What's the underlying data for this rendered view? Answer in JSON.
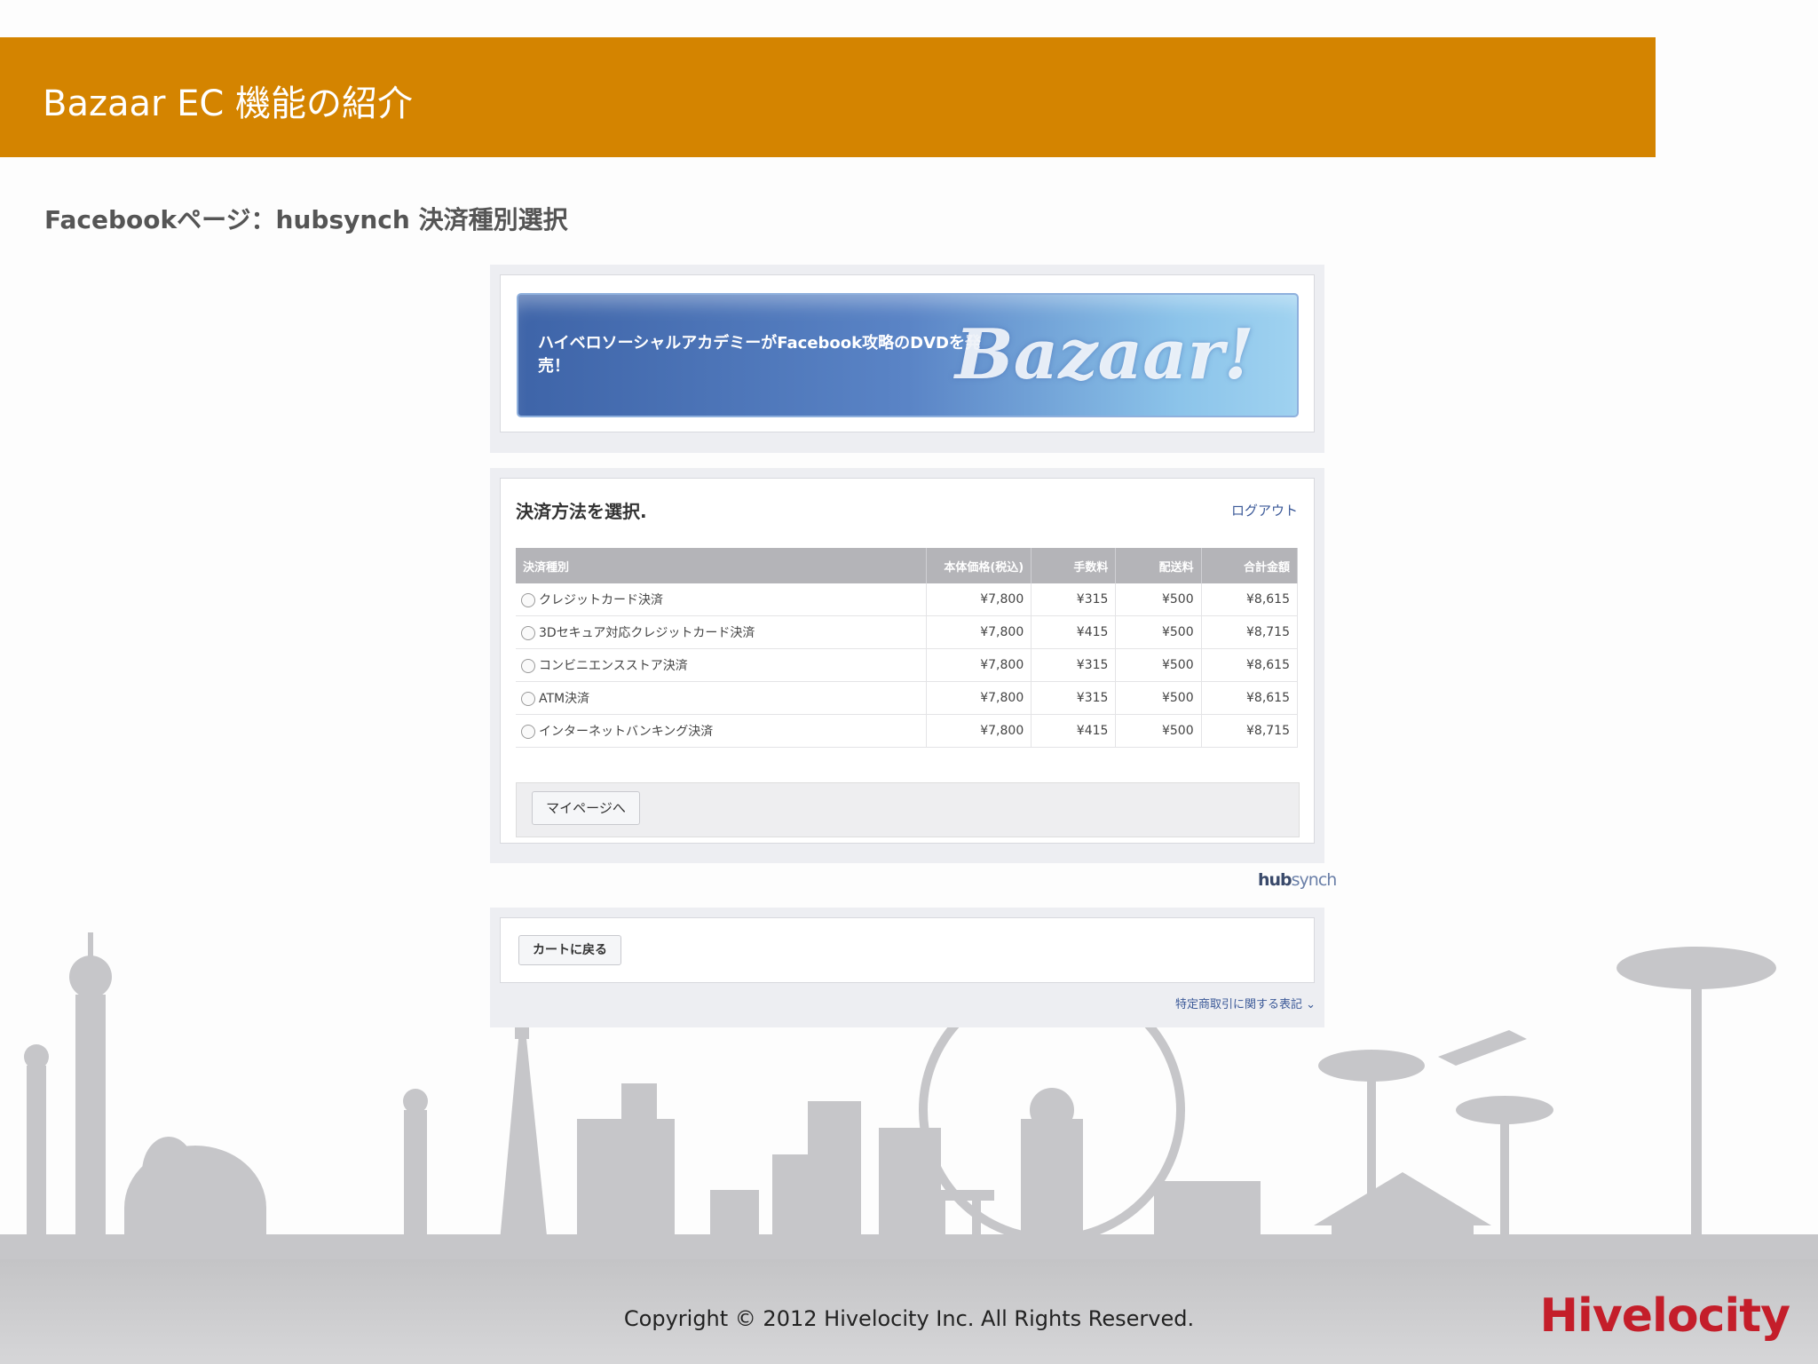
{
  "slide": {
    "title": "Bazaar EC 機能の紹介",
    "subtitle": "Facebookページ：hubsynch 決済種別選択",
    "copyright": "Copyright © 2012 Hivelocity Inc. All Rights Reserved.",
    "brand": "Hivelocity",
    "accent_color": "#d48400"
  },
  "app": {
    "banner": {
      "text": "ハイベロソーシャルアカデミーがFacebook攻略のDVDを発売！",
      "logo": "Bazaar!"
    },
    "payment": {
      "heading": "決済方法を選択.",
      "logout_label": "ログアウト",
      "columns": [
        "決済種別",
        "本体価格(税込)",
        "手数料",
        "配送料",
        "合計金額"
      ],
      "rows": [
        {
          "method": "クレジットカード決済",
          "price": "¥7,800",
          "fee": "¥315",
          "shipping": "¥500",
          "total": "¥8,615"
        },
        {
          "method": "3Dセキュア対応クレジットカード決済",
          "price": "¥7,800",
          "fee": "¥415",
          "shipping": "¥500",
          "total": "¥8,715"
        },
        {
          "method": "コンビニエンスストア決済",
          "price": "¥7,800",
          "fee": "¥315",
          "shipping": "¥500",
          "total": "¥8,615"
        },
        {
          "method": "ATM決済",
          "price": "¥7,800",
          "fee": "¥315",
          "shipping": "¥500",
          "total": "¥8,615"
        },
        {
          "method": "インターネットバンキング決済",
          "price": "¥7,800",
          "fee": "¥415",
          "shipping": "¥500",
          "total": "¥8,715"
        }
      ],
      "mypage_button": "マイページへ"
    },
    "hubsynch_logo": {
      "part1": "hub",
      "part2": "synch"
    },
    "cart_back_button": "カートに戻る",
    "legal_link": "特定商取引に関する表記 ⌄"
  }
}
